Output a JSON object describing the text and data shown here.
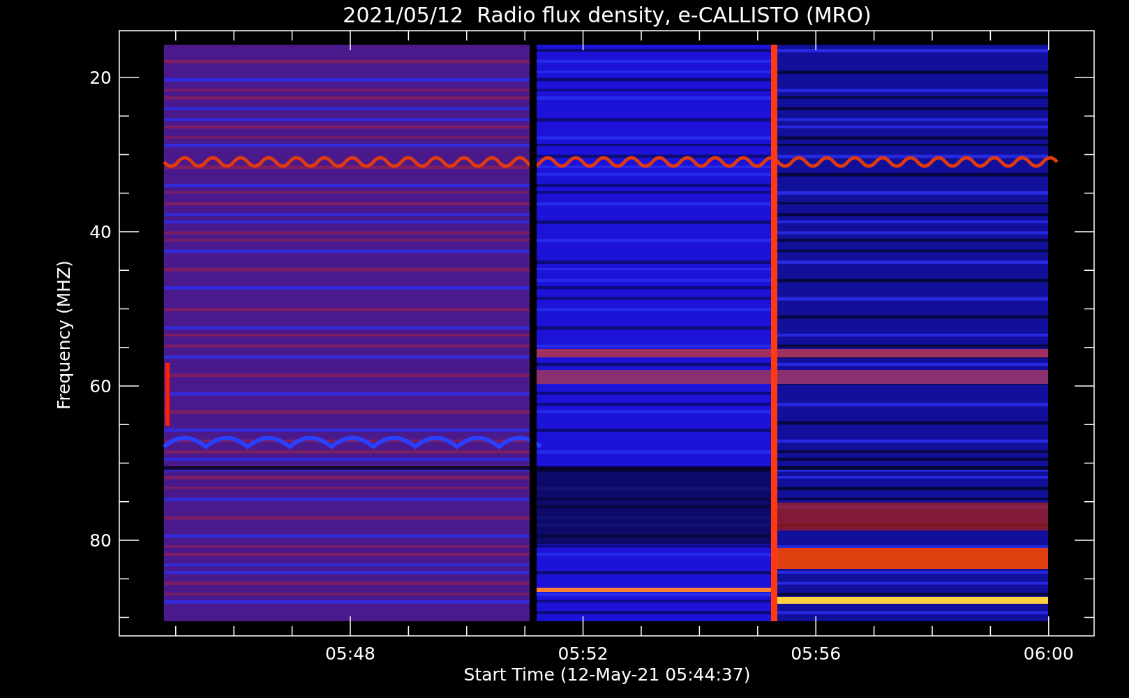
{
  "title": "2021/05/12  Radio flux density, e-CALLISTO (MRO)",
  "y_axis": {
    "label": "Frequency (MHZ)",
    "ticks": [
      "20",
      "40",
      "60",
      "80"
    ]
  },
  "x_axis": {
    "label": "Start Time (12-May-21 05:44:37)",
    "ticks": [
      "05:48",
      "05:52",
      "05:56",
      "06:00"
    ]
  }
}
